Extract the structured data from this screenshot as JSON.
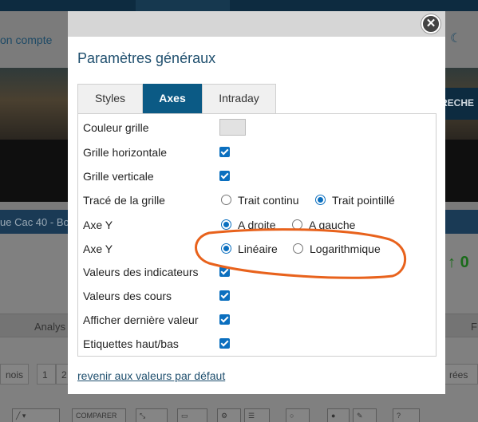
{
  "background": {
    "account_link": "on compte",
    "search_button": "RECHE",
    "stripe_text": "ue Cac 40 - Bo",
    "tab_left": "Analys",
    "tab_right": "F",
    "pager_left": "nois",
    "pager_page1": "1",
    "pager_page2": "2",
    "pager_right": "rées",
    "compare_button": "COMPARER",
    "arrow_value": "0"
  },
  "modal": {
    "title": "Paramètres généraux",
    "close_label": "✕",
    "tabs": [
      {
        "label": "Styles",
        "active": false
      },
      {
        "label": "Axes",
        "active": true
      },
      {
        "label": "Intraday",
        "active": false
      }
    ],
    "rows": {
      "grid_color": "Couleur grille",
      "grid_horizontal": "Grille horizontale",
      "grid_vertical": "Grille verticale",
      "grid_style": "Tracé de la grille",
      "axis_side": "Axe Y",
      "axis_scale": "Axe Y",
      "indicator_values": "Valeurs des indicateurs",
      "price_values": "Valeurs des cours",
      "last_value": "Afficher dernière valeur",
      "high_low_labels": "Etiquettes haut/bas"
    },
    "options": {
      "solid_line": "Trait continu",
      "dotted_line": "Trait pointillé",
      "right": "A droite",
      "left": "A gauche",
      "linear": "Linéaire",
      "logarithmic": "Logarithmique"
    },
    "reset_link": "revenir aux valeurs par défaut"
  },
  "colors": {
    "accent": "#0b5a85",
    "checkbox": "#0b6fbf",
    "annotation": "#e8621c",
    "title": "#1f4f6e"
  }
}
